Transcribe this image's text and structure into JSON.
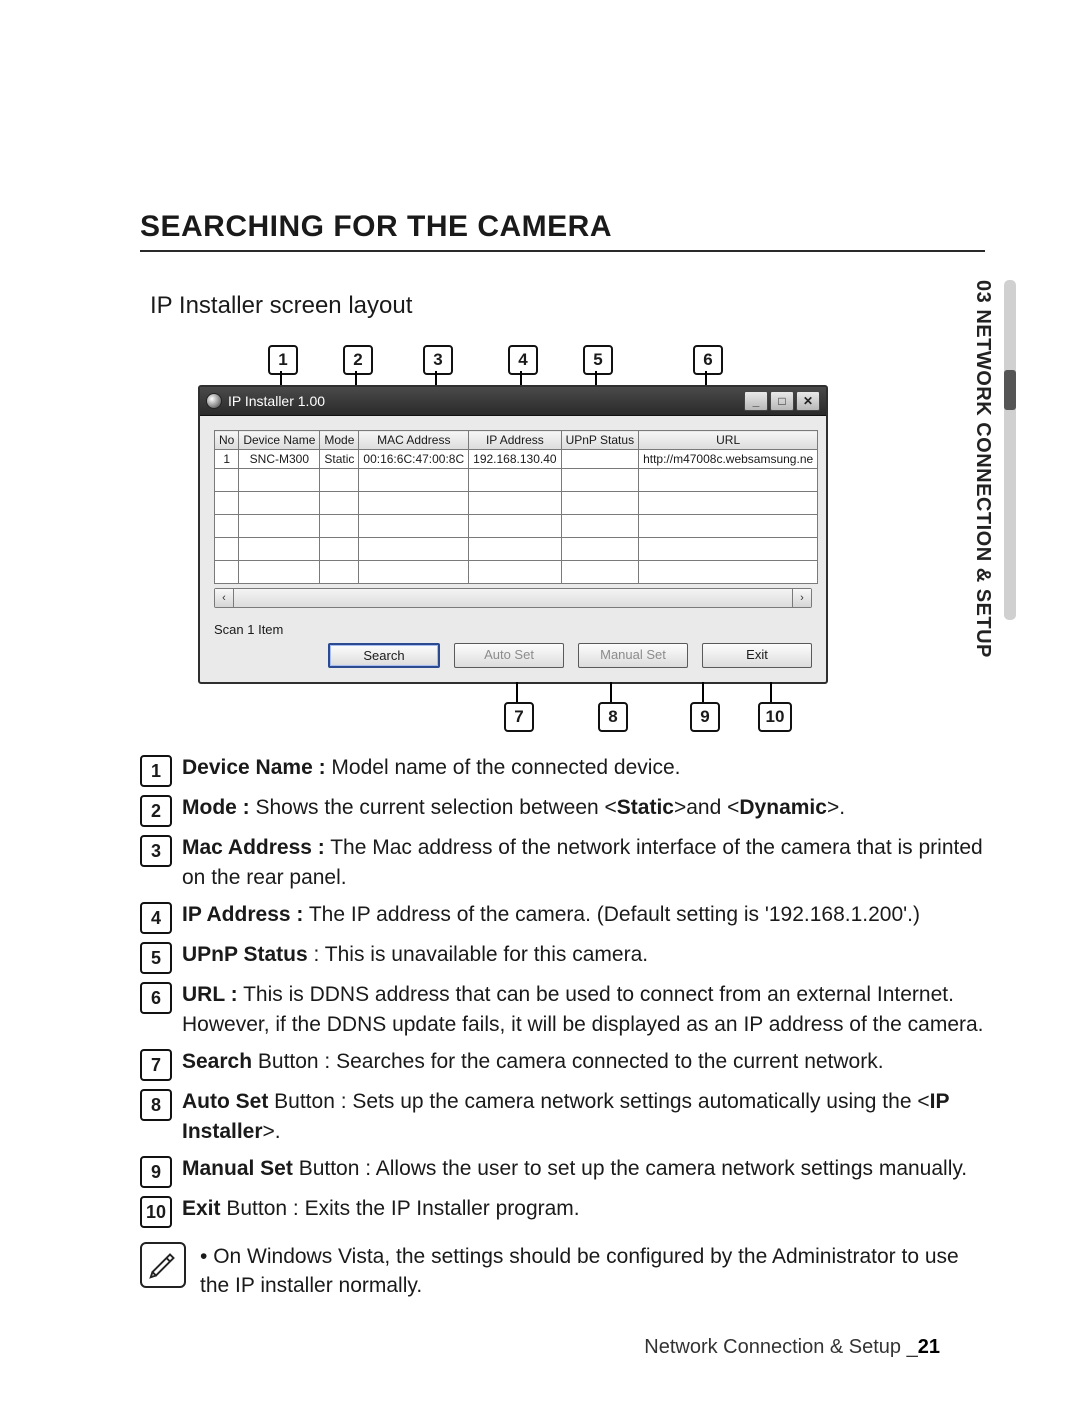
{
  "side_tab": {
    "chapter_no": "03",
    "chapter_title": "NETWORK CONNECTION & SETUP"
  },
  "heading1": "SEARCHING FOR THE CAMERA",
  "heading2": "IP Installer screen layout",
  "callouts_top": [
    "1",
    "2",
    "3",
    "4",
    "5",
    "6"
  ],
  "callouts_bot": [
    "7",
    "8",
    "9",
    "10"
  ],
  "window": {
    "title": "IP Installer 1.00",
    "columns": [
      "No",
      "Device Name",
      "Mode",
      "MAC Address",
      "IP Address",
      "UPnP Status",
      "URL"
    ],
    "row": {
      "no": "1",
      "device": "SNC-M300",
      "mode": "Static",
      "mac": "00:16:6C:47:00:8C",
      "ip": "192.168.130.40",
      "upnp": "",
      "url": "http://m47008c.websamsung.ne"
    },
    "status": "Scan 1 Item",
    "buttons": {
      "search": "Search",
      "auto": "Auto Set",
      "manual": "Manual Set",
      "exit": "Exit"
    }
  },
  "desc": [
    {
      "n": "1",
      "html": "<b>Device Name :</b> Model name of the connected device."
    },
    {
      "n": "2",
      "html": "<b>Mode :</b> Shows the current selection between &lt;<b>Static</b>&gt;and &lt;<b>Dynamic</b>&gt;."
    },
    {
      "n": "3",
      "html": "<b>Mac Address :</b> The Mac address of the network interface of the camera that is printed on the rear panel."
    },
    {
      "n": "4",
      "html": "<b>IP Address :</b> The IP address of the camera. (Default setting is '192.168.1.200'.)"
    },
    {
      "n": "5",
      "html": "<b>UPnP Status</b> : This is unavailable for this camera."
    },
    {
      "n": "6",
      "html": "<b>URL :</b> This is DDNS address that can be used to connect from an external Internet. However, if the DDNS update fails, it will be displayed as an IP address of the camera."
    },
    {
      "n": "7",
      "html": "<b>Search</b> Button : Searches for the camera connected to the current network."
    },
    {
      "n": "8",
      "html": "<b>Auto Set</b> Button : Sets up the camera network settings automatically using the &lt;<b>IP Installer</b>&gt;."
    },
    {
      "n": "9",
      "html": "<b>Manual Set</b> Button : Allows the user to set up the camera network settings manually."
    },
    {
      "n": "10",
      "html": "<b>Exit</b> Button : Exits the IP Installer program."
    }
  ],
  "note": "On Windows Vista, the settings should be configured by the Administrator to use the IP installer normally.",
  "footer": {
    "section": "Network Connection & Setup",
    "sep": "_",
    "page": "21"
  }
}
